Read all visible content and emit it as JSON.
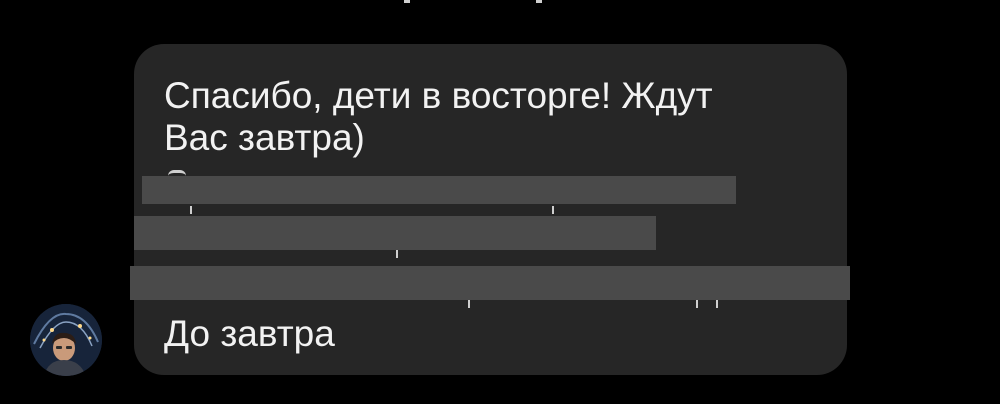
{
  "message": {
    "lines": [
      "Спасибо, дети в восторге! Ждут",
      "Вас завтра)",
      "До завтра"
    ],
    "redacted_line_count": 3
  },
  "avatar": {
    "icon": "user-avatar-photo"
  },
  "colors": {
    "background": "#000000",
    "bubble": "#262626",
    "text": "#f2f2f2",
    "redaction": "#4a4a4a"
  }
}
